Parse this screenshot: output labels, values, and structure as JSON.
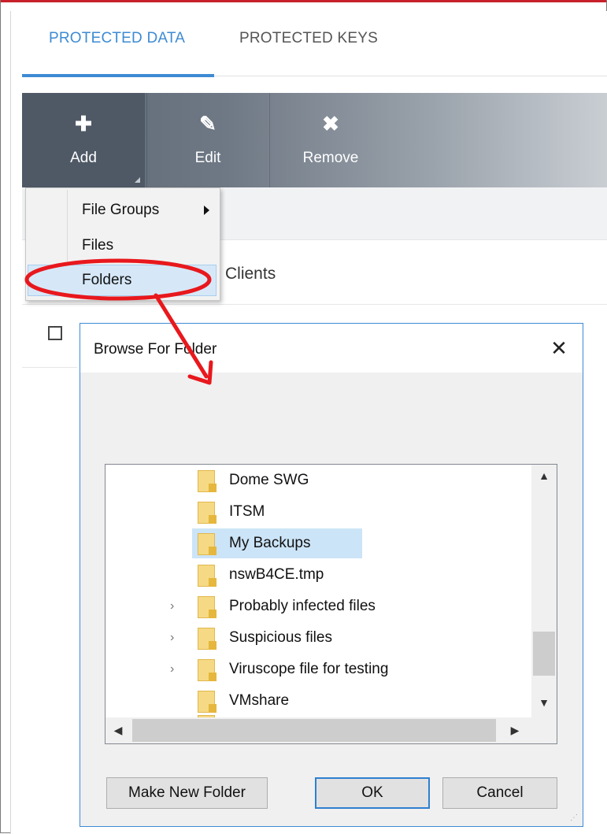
{
  "tabs": {
    "protected_data": "PROTECTED DATA",
    "protected_keys": "PROTECTED KEYS"
  },
  "toolbar": {
    "add": {
      "label": "Add",
      "icon": "plus-icon",
      "glyph": "✚"
    },
    "edit": {
      "label": "Edit",
      "icon": "pencil-icon",
      "glyph": "✎"
    },
    "remove": {
      "label": "Remove",
      "icon": "remove-x-icon",
      "glyph": "✖"
    }
  },
  "table": {
    "column_clients": "Clients"
  },
  "add_menu": {
    "items": [
      {
        "label": "File Groups",
        "has_submenu": true
      },
      {
        "label": "Files",
        "has_submenu": false
      },
      {
        "label": "Folders",
        "has_submenu": false,
        "highlighted": true
      }
    ]
  },
  "dialog": {
    "title": "Browse For Folder",
    "close_glyph": "✕",
    "tree": [
      {
        "label": "Dome SWG",
        "expandable": false,
        "selected": false
      },
      {
        "label": "ITSM",
        "expandable": false,
        "selected": false
      },
      {
        "label": "My Backups",
        "expandable": false,
        "selected": true
      },
      {
        "label": "nswB4CE.tmp",
        "expandable": false,
        "selected": false
      },
      {
        "label": "Probably infected files",
        "expandable": true,
        "selected": false
      },
      {
        "label": "Suspicious files",
        "expandable": true,
        "selected": false
      },
      {
        "label": "Viruscope file for testing",
        "expandable": true,
        "selected": false
      },
      {
        "label": "VMshare",
        "expandable": false,
        "selected": false
      }
    ],
    "buttons": {
      "make_new_folder": "Make New Folder",
      "ok": "OK",
      "cancel": "Cancel"
    }
  },
  "colors": {
    "accent": "#3d8bd3",
    "annotation": "#e8181d",
    "selection": "#cce4f7"
  }
}
